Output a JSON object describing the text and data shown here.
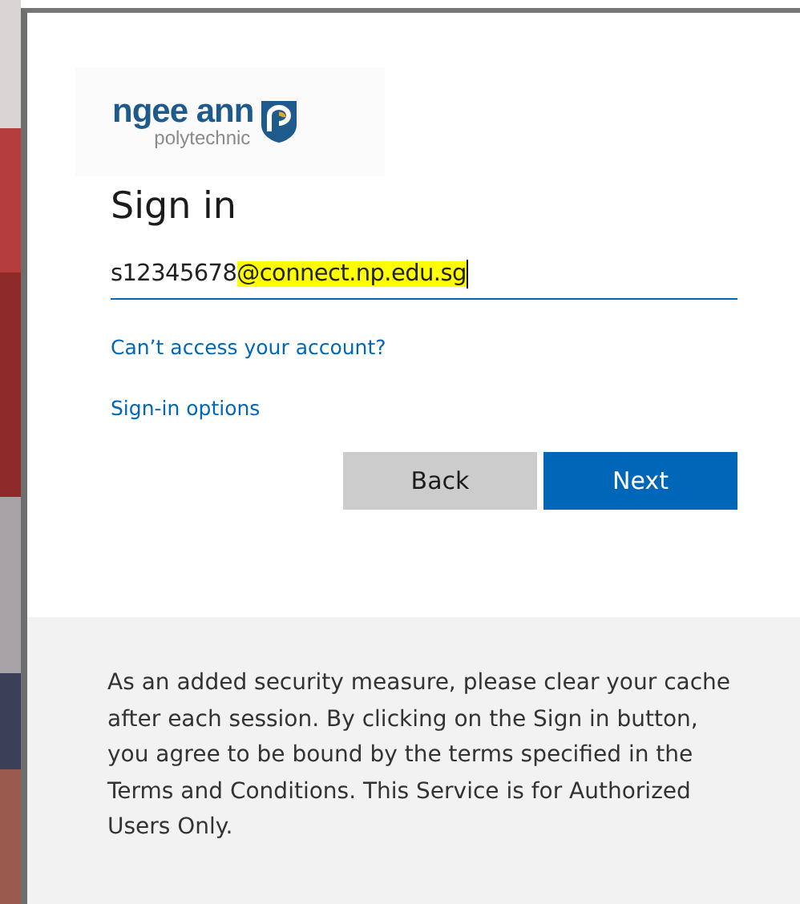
{
  "logo": {
    "name": "ngee ann",
    "subtitle": "polytechnic"
  },
  "title": "Sign in",
  "email_field": {
    "value": "s12345678",
    "highlighted": "@connect.np.edu.sg"
  },
  "links": [
    "Can’t access your account?",
    "Sign-in options"
  ],
  "buttons": [
    {
      "label": "Back",
      "kind": "secondary"
    },
    {
      "label": "Next",
      "kind": "primary"
    }
  ],
  "footer_note": "As an added security measure, please clear your cache after each session. By clicking on the Sign in button, you agree to be bound by the terms specified in the Terms and Conditions. This Service is for Authorized Users Only."
}
